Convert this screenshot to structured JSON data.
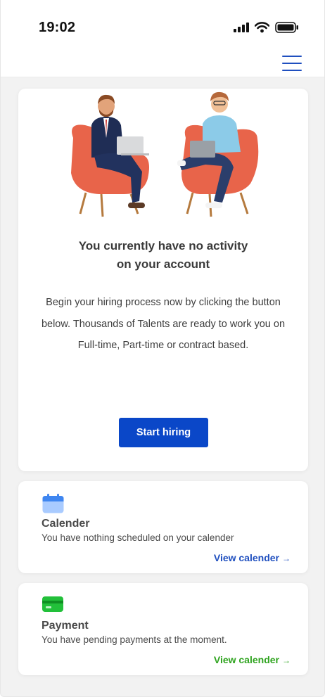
{
  "status_bar": {
    "time": "19:02"
  },
  "header": {
    "menu_icon": "hamburger-menu-icon"
  },
  "empty_state": {
    "title_line1": "You currently have no activity",
    "title_line2": "on your account",
    "description": "Begin your hiring process now by clicking the button below. Thousands of Talents are ready to work you on Full-time, Part-time or contract based.",
    "button_label": "Start hiring"
  },
  "calendar_card": {
    "icon": "calendar-icon",
    "title": "Calender",
    "subtitle": "You have nothing scheduled on your calender",
    "link": "View calender",
    "link_arrow": "→",
    "accent_color": "#1f4fbf"
  },
  "payment_card": {
    "icon": "credit-card-icon",
    "title": "Payment",
    "subtitle": "You have pending payments at the moment.",
    "link": "View calender",
    "link_arrow": "→",
    "accent_color": "#2ea31e"
  },
  "colors": {
    "primary": "#0a47c8",
    "background": "#f2f2f2",
    "chair": "#e8644a"
  }
}
